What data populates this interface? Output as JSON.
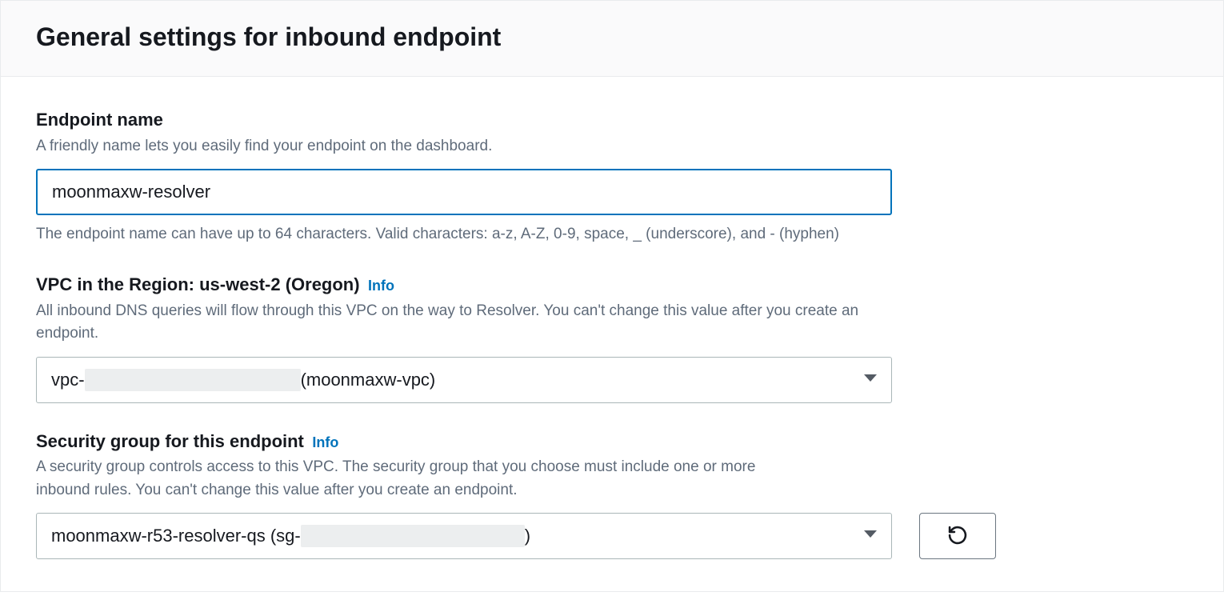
{
  "panel": {
    "title": "General settings for inbound endpoint"
  },
  "endpointName": {
    "label": "Endpoint name",
    "hint": "A friendly name lets you easily find your endpoint on the dashboard.",
    "value": "moonmaxw-resolver",
    "constraint": "The endpoint name can have up to 64 characters. Valid characters: a-z, A-Z, 0-9, space, _ (underscore), and - (hyphen)"
  },
  "vpc": {
    "label": "VPC in the Region: us-west-2 (Oregon)",
    "info": "Info",
    "hint": "All inbound DNS queries will flow through this VPC on the way to Resolver. You can't change this value after you create an endpoint.",
    "selectedPrefix": "vpc-",
    "selectedSuffix": " (moonmaxw-vpc)"
  },
  "securityGroup": {
    "label": "Security group for this endpoint",
    "info": "Info",
    "hint": "A security group controls access to this VPC. The security group that you choose must include one or more inbound rules. You can't change this value after you create an endpoint.",
    "selectedPrefix": "moonmaxw-r53-resolver-qs (sg-",
    "selectedSuffix": ")"
  }
}
